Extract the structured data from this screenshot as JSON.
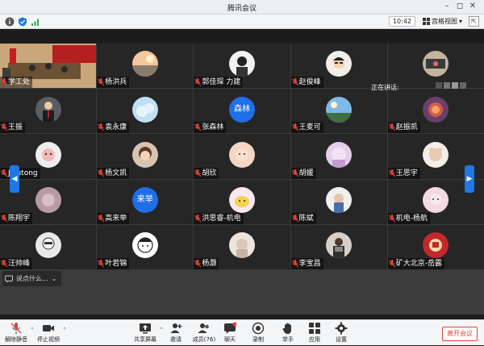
{
  "window": {
    "title": "腾讯会议"
  },
  "toolbar": {
    "time": "10:42",
    "view_label": "宫格视图"
  },
  "participants": [
    "学工处",
    "杨洪兵",
    "郭佳琛 力建",
    "赵俊峰",
    "",
    "王振",
    "袁永康",
    "张森林",
    "王麦可",
    "赵振凯",
    "Jiyutong",
    "杨文凯",
    "胡欣",
    "胡媛",
    "王思宇",
    "陈翔宇",
    "高来举",
    "洪思睿-机电",
    "陈斌",
    "机电-杨航",
    "汪帅峰",
    "叶若锦",
    "杨灏",
    "李宝昌",
    "矿大北京-岳露"
  ],
  "avatar_texts": {
    "zhangsenlin": "森林",
    "gaolaiju": "来举"
  },
  "speaking_label": "正在讲话:",
  "chat_preview": "说点什么...",
  "bottom": {
    "unmute": "解除静音",
    "stop_video": "停止视频",
    "share_screen": "共享屏幕",
    "invite": "邀请",
    "members": "成员(76)",
    "chat": "聊天",
    "record": "录制",
    "raise_hand": "举手",
    "apps": "应用",
    "settings": "设置",
    "leave": "离开会议"
  },
  "colors": {
    "accent": "#1e78e6",
    "leave": "#e0433a",
    "muted": "#e0433a"
  }
}
